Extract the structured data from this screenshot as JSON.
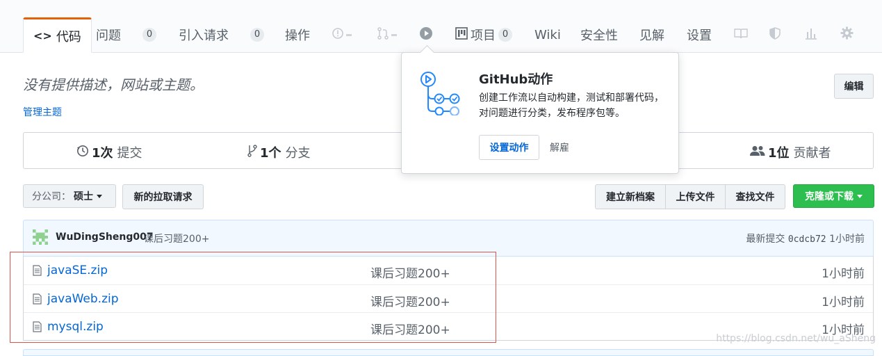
{
  "tabs": {
    "code": "代码",
    "issues": "问题",
    "issues_count": "0",
    "pulls": "引入请求",
    "pulls_count": "0",
    "actions": "操作",
    "projects": "项目",
    "projects_count": "0",
    "wiki": "Wiki",
    "security": "安全性",
    "insights": "见解",
    "settings": "设置"
  },
  "repo": {
    "description": "没有提供描述，网站或主题。",
    "manage_topics": "管理主题",
    "edit": "编辑"
  },
  "summary": {
    "commits_count": "1次",
    "commits_label": "提交",
    "branches_count": "1个",
    "branches_label": "分支",
    "contributors_count": "1位",
    "contributors_label": "贡献者"
  },
  "toolbar": {
    "branch_label": "分公司：",
    "branch_value": "硕士",
    "new_pull_request": "新的拉取请求",
    "create_new_file": "建立新档案",
    "upload_files": "上传文件",
    "find_file": "查找文件",
    "clone_download": "克隆或下载"
  },
  "commit": {
    "author": "WuDingSheng007",
    "message": "课后习题200+",
    "latest_label": "最新提交",
    "sha": "0cdcb72",
    "age": "1小时前"
  },
  "files": [
    {
      "name": "javaSE.zip",
      "message": "课后习题200+",
      "age": "1小时前"
    },
    {
      "name": "javaWeb.zip",
      "message": "课后习题200+",
      "age": "1小时前"
    },
    {
      "name": "mysql.zip",
      "message": "课后习题200+",
      "age": "1小时前"
    }
  ],
  "popover": {
    "title": "GitHub动作",
    "body": "创建工作流以自动构建，测试和部署代码，对问题进行分类，发布程序包等。",
    "primary": "设置动作",
    "dismiss": "解雇"
  },
  "watermark": "https://blog.csdn.net/wu_aSheng",
  "colors": {
    "accent": "#0366d6",
    "tab_highlight": "#e36209",
    "clone_green": "#2cbe4e",
    "annotation_red": "#d9534f"
  }
}
